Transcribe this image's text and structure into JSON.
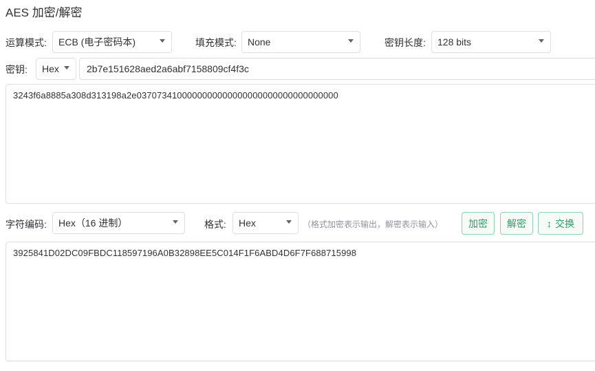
{
  "page_title": "AES 加密/解密",
  "mode": {
    "label": "运算模式:",
    "value": "ECB (电子密码本)"
  },
  "padding": {
    "label": "填充模式:",
    "value": "None"
  },
  "key_length": {
    "label": "密钥长度:",
    "value": "128 bits"
  },
  "key": {
    "label": "密钥:",
    "format": "Hex",
    "value": "2b7e151628aed2a6abf7158809cf4f3c"
  },
  "input_text": "3243f6a8885a308d313198a2e0370734100000000000000000000000000000000",
  "encoding": {
    "label": "字符编码:",
    "value": "Hex（16 进制）"
  },
  "output_format": {
    "label": "格式:",
    "value": "Hex",
    "hint": "（格式加密表示输出，解密表示输入）"
  },
  "buttons": {
    "encrypt": "加密",
    "decrypt": "解密",
    "swap_icon": "↕",
    "swap": "交换"
  },
  "output_text": "3925841D02DC09FBDC118597196A0B32898EE5C014F1F6ABD4D6F7F688715998",
  "colors": {
    "accent": "#2e9a64",
    "border": "#dcdfe6",
    "hint": "#909399"
  }
}
